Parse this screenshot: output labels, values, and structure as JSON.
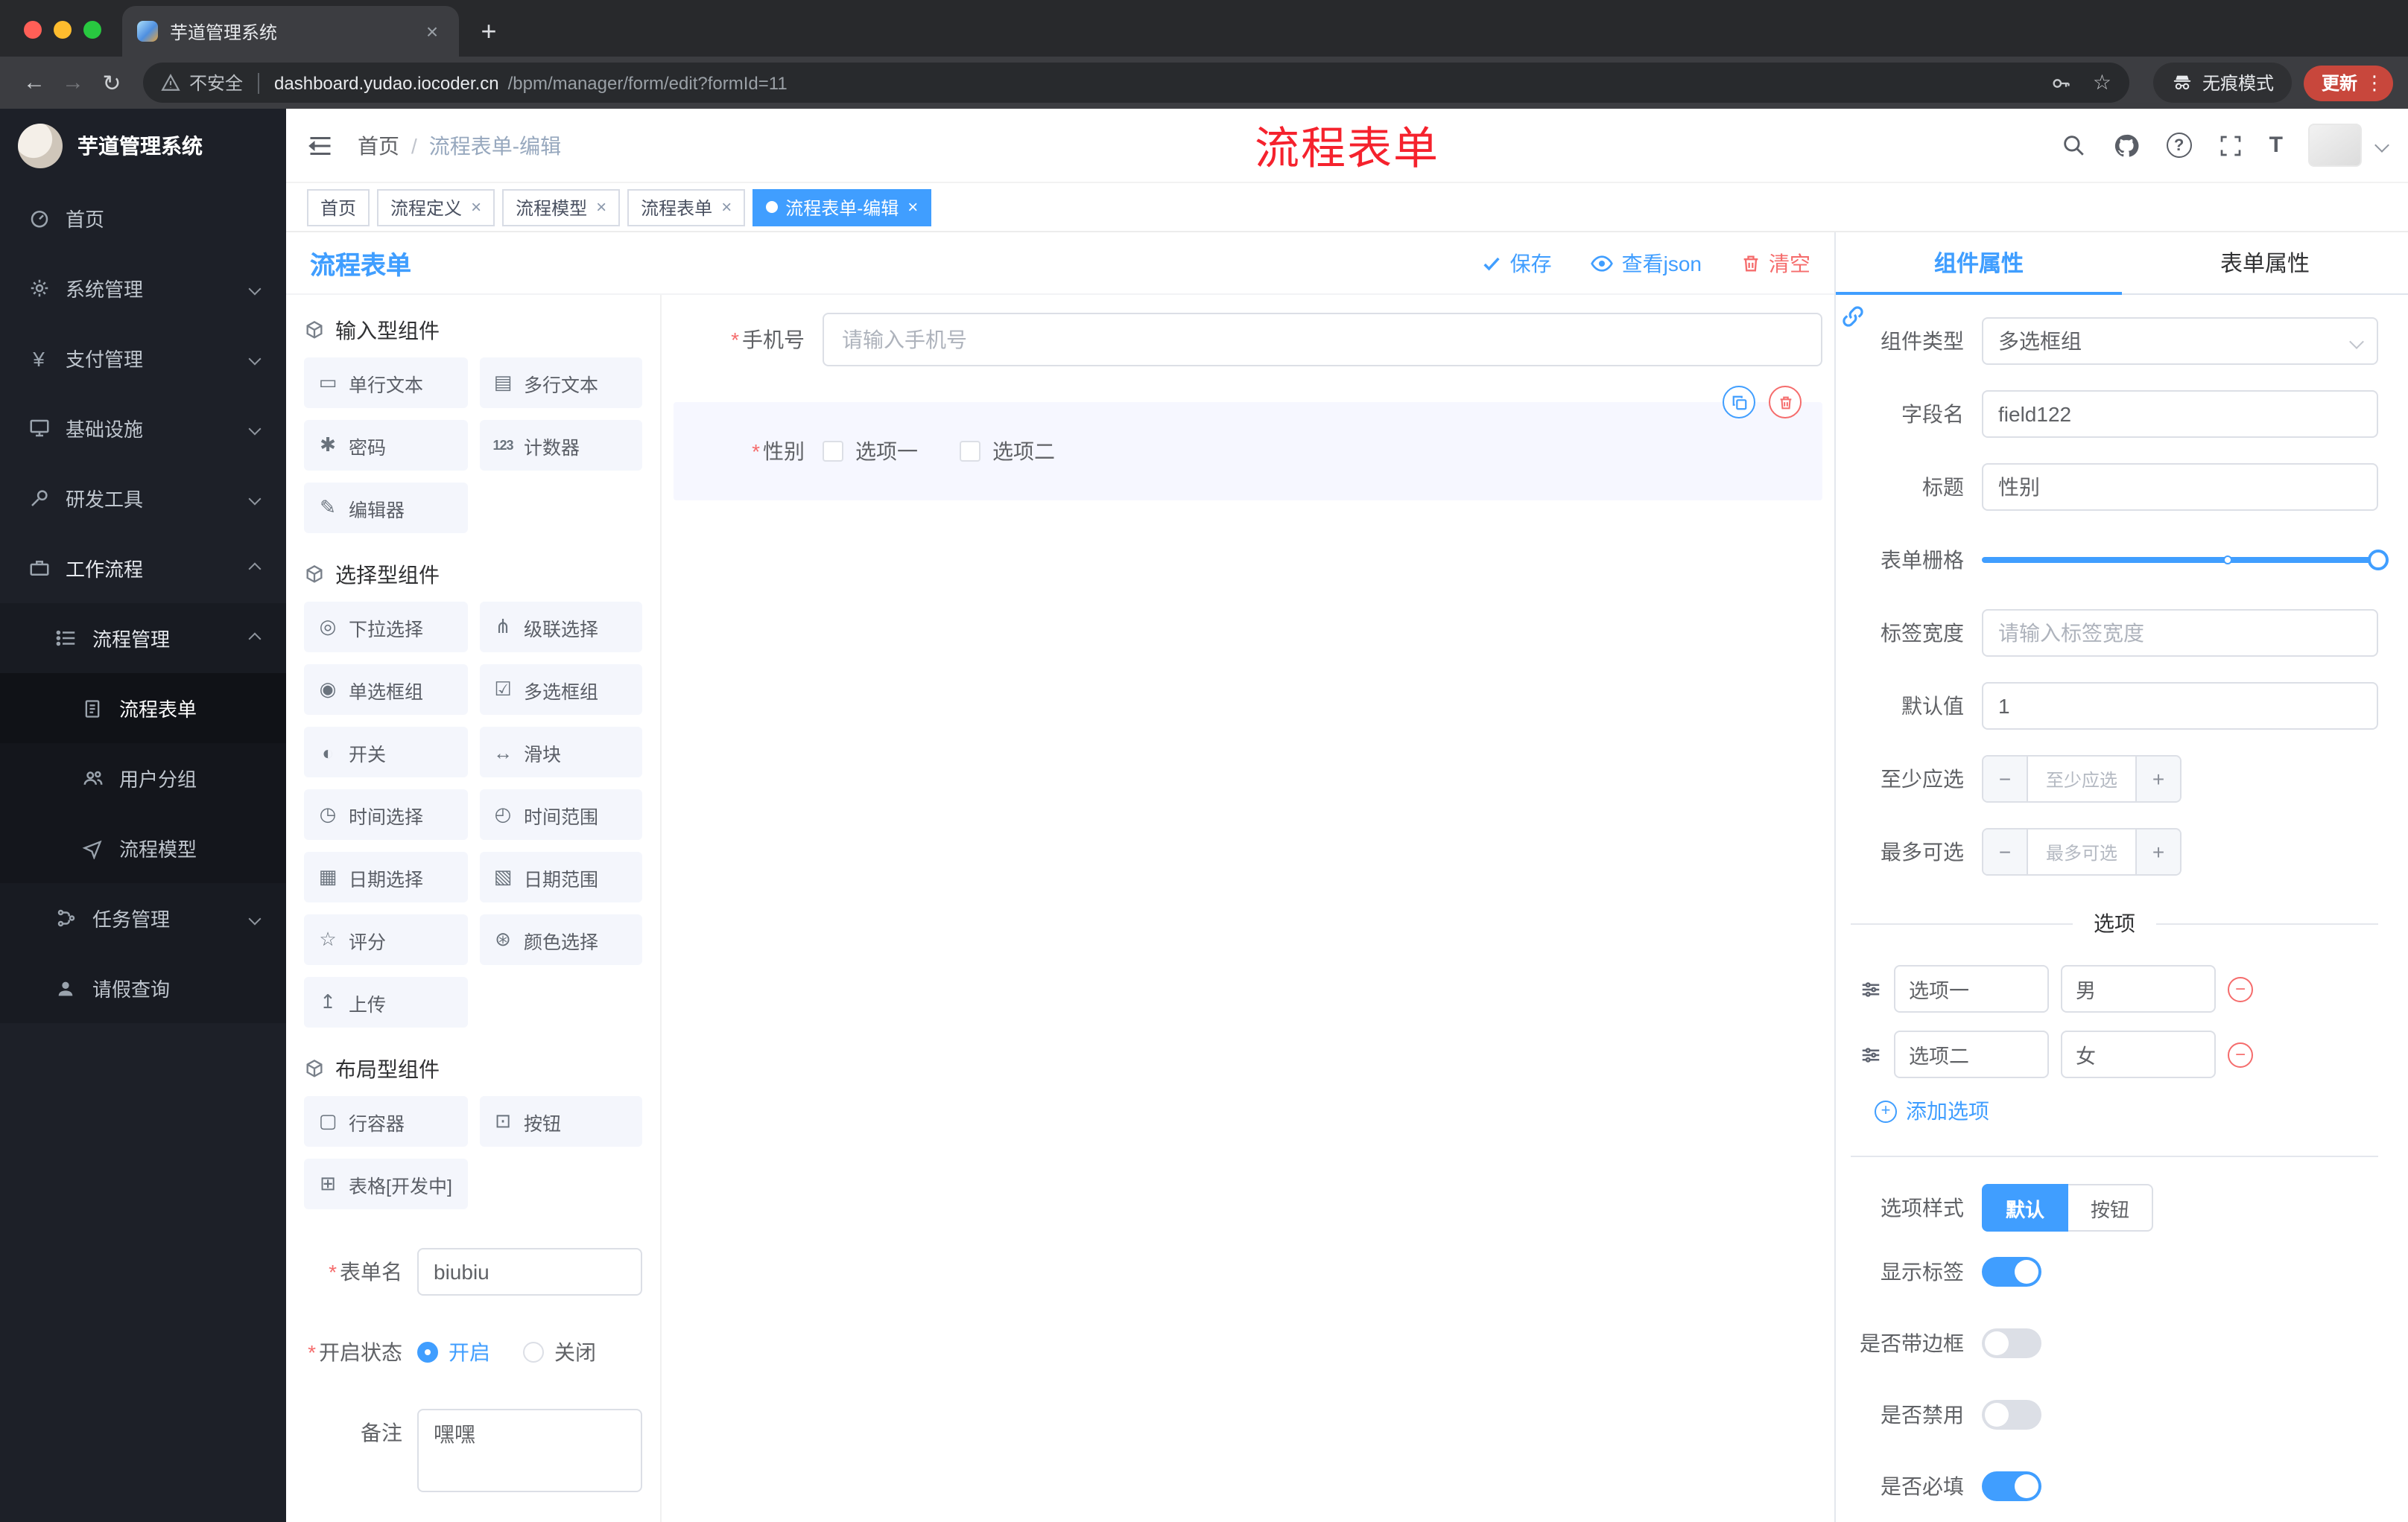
{
  "theme": {
    "primary": "#409eff",
    "danger": "#f56c6c",
    "annotation_red": "#f5222d",
    "sidebar_bg": "#1d2028",
    "update_pill": "#c8473c",
    "active_tag_bg": "#409eff"
  },
  "browser": {
    "tab_title": "芋道管理系统",
    "security_label": "不安全",
    "url_domain": "dashboard.yudao.iocoder.cn",
    "url_path": "/bpm/manager/form/edit?formId=11",
    "incognito_label": "无痕模式",
    "update_label": "更新"
  },
  "icons": {
    "close": "×",
    "new_tab": "+",
    "more_vert": "⋮",
    "back": "←",
    "forward": "→",
    "reload": "↻",
    "star": "☆",
    "question": "?",
    "text_size": "T",
    "yen": "¥",
    "minus": "−",
    "plus": "+",
    "single_text": "▭",
    "textarea": "▤",
    "password": "✱",
    "counter": "123",
    "editor": "✎",
    "select": "◎",
    "cascader": "⋔",
    "radio_group": "◉",
    "checkbox_group": "☑",
    "switch": "◐",
    "slider": "↔",
    "time": "◷",
    "time_range": "◴",
    "date": "▦",
    "date_range": "▧",
    "rate": "☆",
    "color": "⊛",
    "upload": "↥",
    "row_container": "▢",
    "button": "⊡",
    "table": "⊞"
  },
  "sidebar": {
    "logo_title": "芋道管理系统",
    "items": [
      {
        "label": "首页"
      },
      {
        "label": "系统管理"
      },
      {
        "label": "支付管理"
      },
      {
        "label": "基础设施"
      },
      {
        "label": "研发工具"
      },
      {
        "label": "工作流程"
      },
      {
        "label": "流程管理"
      },
      {
        "label": "流程表单"
      },
      {
        "label": "用户分组"
      },
      {
        "label": "流程模型"
      },
      {
        "label": "任务管理"
      },
      {
        "label": "请假查询"
      }
    ]
  },
  "header": {
    "breadcrumb_home": "首页",
    "breadcrumb_sep": "/",
    "breadcrumb_current": "流程表单-编辑",
    "annotation": "流程表单"
  },
  "tags": {
    "items": [
      {
        "label": "首页"
      },
      {
        "label": "流程定义"
      },
      {
        "label": "流程模型"
      },
      {
        "label": "流程表单"
      },
      {
        "label": "流程表单-编辑"
      }
    ]
  },
  "designer": {
    "title": "流程表单",
    "save_label": "保存",
    "view_json_label": "查看json",
    "clear_label": "清空",
    "group_input_title": "输入型组件",
    "group_select_title": "选择型组件",
    "group_layout_title": "布局型组件",
    "palette_input": [
      "单行文本",
      "多行文本",
      "密码",
      "计数器",
      "编辑器"
    ],
    "palette_select": [
      "下拉选择",
      "级联选择",
      "单选框组",
      "多选框组",
      "开关",
      "滑块",
      "时间选择",
      "时间范围",
      "日期选择",
      "日期范围",
      "评分",
      "颜色选择",
      "上传"
    ],
    "palette_layout": [
      "行容器",
      "按钮",
      "表格[开发中]"
    ],
    "meta": {
      "name_label": "表单名",
      "name_value": "biubiu",
      "status_label": "开启状态",
      "status_on": "开启",
      "status_off": "关闭",
      "remark_label": "备注",
      "remark_value": "嘿嘿"
    },
    "canvas": {
      "phone_label": "手机号",
      "phone_placeholder": "请输入手机号",
      "gender_label": "性别",
      "gender_option1": "选项一",
      "gender_option2": "选项二"
    }
  },
  "props": {
    "tab_component": "组件属性",
    "tab_form": "表单属性",
    "type_label": "组件类型",
    "type_value": "多选框组",
    "field_label": "字段名",
    "field_value": "field122",
    "title_label": "标题",
    "title_value": "性别",
    "grid_label": "表单栅格",
    "label_width_label": "标签宽度",
    "label_width_placeholder": "请输入标签宽度",
    "default_label": "默认值",
    "default_value": "1",
    "min_label": "至少应选",
    "min_placeholder": "至少应选",
    "max_label": "最多可选",
    "max_placeholder": "最多可选",
    "options_divider": "选项",
    "option_rows": [
      {
        "label": "选项一",
        "value": "男"
      },
      {
        "label": "选项二",
        "value": "女"
      }
    ],
    "add_option": "添加选项",
    "style_label": "选项样式",
    "style_default": "默认",
    "style_button": "按钮",
    "toggle_show_label": "显示标签",
    "toggle_border": "是否带边框",
    "toggle_disabled": "是否禁用",
    "toggle_required": "是否必填"
  }
}
